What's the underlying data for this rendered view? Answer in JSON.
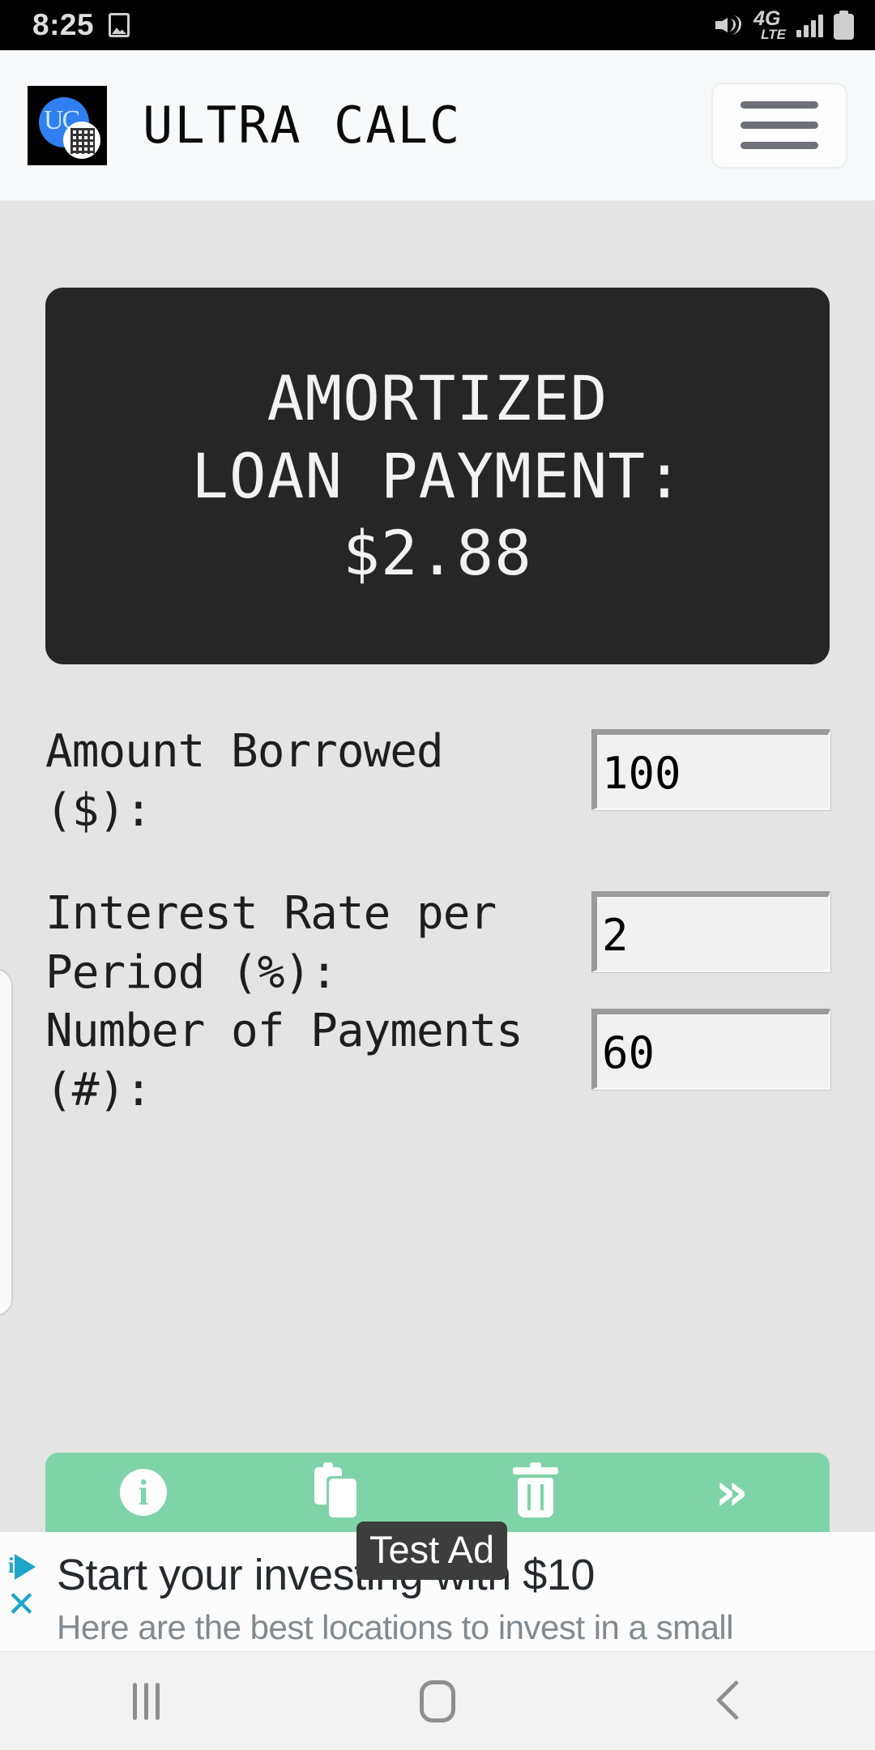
{
  "status_bar": {
    "time": "8:25",
    "icons": {
      "gallery": "image-icon",
      "mute": "mute-vibrate-icon",
      "network_main": "4G",
      "network_sub": "LTE",
      "signal": "signal-bars-icon",
      "battery": "battery-icon"
    }
  },
  "header": {
    "app_title": "ULTRA CALC",
    "logo_text": "UC",
    "logo_alt": "ultra-calc-logo",
    "menu_label": "hamburger-menu"
  },
  "result": {
    "lines": [
      "AMORTIZED",
      "LOAN PAYMENT:",
      "$2.88"
    ],
    "label": "AMORTIZED LOAN PAYMENT:",
    "value": "$2.88",
    "background": "#262626",
    "text_color": "#f2f2f2"
  },
  "form": {
    "fields": [
      {
        "label": "Amount Borrowed ($):",
        "value": "100",
        "name": "amount-borrowed"
      },
      {
        "label": "Interest Rate per Period (%):",
        "value": "2",
        "name": "interest-rate"
      },
      {
        "label": "Number of Payments (#):",
        "value": "60",
        "name": "number-of-payments"
      }
    ]
  },
  "toolbar": {
    "background": "#7fd3a8",
    "buttons": [
      {
        "name": "info-icon",
        "label": "i"
      },
      {
        "name": "copy-icon",
        "label": ""
      },
      {
        "name": "delete-icon",
        "label": ""
      },
      {
        "name": "next-icon",
        "label": "»"
      }
    ]
  },
  "ad": {
    "badge": "Test Ad",
    "title": "Start your investing with $10",
    "subtitle": "Here are the best locations to invest in a small",
    "adchoices_icon": "adchoices-icon",
    "close_icon": "close-icon",
    "accent": "#1ea6c9"
  },
  "nav_bar": {
    "recents": "recents-icon",
    "home": "home-icon",
    "back": "back-icon"
  }
}
